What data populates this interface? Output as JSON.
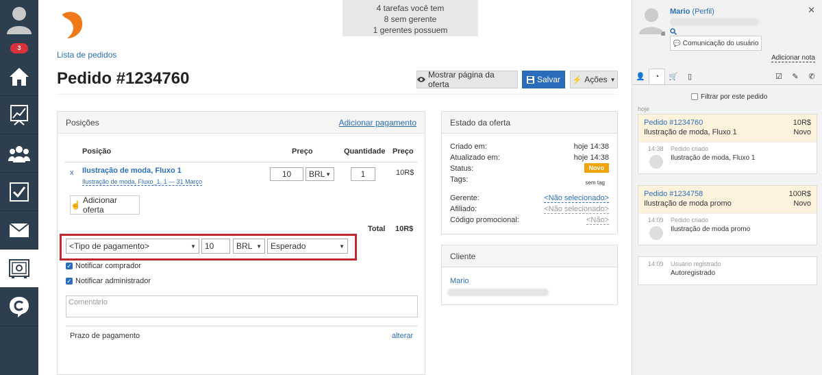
{
  "nav": {
    "badge": "3"
  },
  "header": {
    "breadcrumb": "Lista de pedidos",
    "tasks": [
      "4 tarefas você tem",
      "8 sem gerente",
      "1 gerentes possuem"
    ],
    "title": "Pedido #1234760",
    "btn_show": "Mostrar página da oferta",
    "btn_save": "Salvar",
    "btn_actions": "Ações"
  },
  "positions": {
    "title": "Posições",
    "add_payment": "Adicionar pagamento",
    "col_position": "Posição",
    "col_price": "Preço",
    "col_qty": "Quantidade",
    "col_price2": "Preço",
    "row": {
      "remove": "x",
      "name": "Ilustração de moda, Fluxo 1",
      "sub": "Ilustração de moda, Fluxo_1, 1 — 31 Março",
      "price": "10",
      "currency": "BRL",
      "qty": "1",
      "total": "10R$"
    },
    "add_offer": "Adicionar oferta",
    "total_label": "Total",
    "total_value": "10R$"
  },
  "payment": {
    "type_placeholder": "<Tipo de pagamento>",
    "amount": "10",
    "currency": "BRL",
    "status": "Esperado",
    "notify_buyer": "Notificar comprador",
    "notify_admin": "Notificar administrador",
    "comment_placeholder": "Comentário",
    "deadline_label": "Prazo de pagamento",
    "deadline_action": "alterar"
  },
  "offer_state": {
    "title": "Estado da oferta",
    "created_label": "Criado em:",
    "created_value": "hoje 14:38",
    "updated_label": "Atualizado em:",
    "updated_value": "hoje 14:38",
    "status_label": "Status:",
    "status_value": "Novo",
    "tags_label": "Tags:",
    "tags_value": "sem tag",
    "manager_label": "Gerente:",
    "manager_value": "<Não selecionado>",
    "affiliate_label": "Afiliado:",
    "affiliate_value": "<Não selecionado>",
    "promo_label": "Código promocional:",
    "promo_value": "<Não>"
  },
  "client": {
    "title": "Cliente",
    "name": "Mario"
  },
  "side": {
    "user_name": "Mario",
    "profile_link": "(Perfil)",
    "comm_button": "Comunicação do usuário",
    "add_note": "Adicionar nota",
    "filter_label": "Filtrar por este pedido",
    "day": "hoje",
    "cards": [
      {
        "order": "Pedido #1234760",
        "amount": "10R$",
        "product": "Ilustração de moda, Fluxo 1",
        "status": "Novo",
        "time": "14:38",
        "event": "Pedido criado",
        "detail": "Ilustração de moda, Fluxo 1"
      },
      {
        "order": "Pedido #1234758",
        "amount": "100R$",
        "product": "Ilustração de moda promo",
        "status": "Novo",
        "time": "14:09",
        "event": "Pedido criado",
        "detail": "Ilustração de moda promo"
      }
    ],
    "reg": {
      "time": "14:09",
      "event": "Usuário registrado",
      "detail": "Autoregistrado"
    }
  },
  "colors": {
    "nav": "#2d3e4e",
    "accent": "#2a6ebb",
    "status_orange": "#f0a30a",
    "highlight_red": "#c0282d"
  }
}
